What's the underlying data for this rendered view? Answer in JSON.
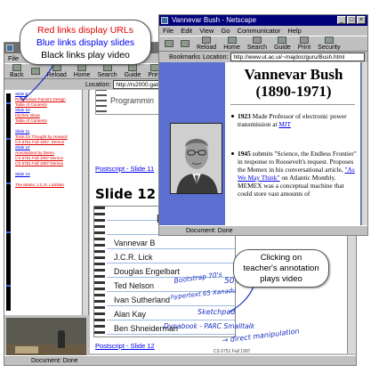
{
  "callouts": {
    "legend": {
      "red_line": "Red links display URLs",
      "blue_line": "Blue links display slides",
      "black_line": "Black links play video"
    },
    "clicking_lines": [
      "Clicking on",
      "teacher's annotation",
      "plays video"
    ]
  },
  "lecture_window": {
    "menu": [
      "File"
    ],
    "toolbar": [
      "Back",
      "",
      "Reload",
      "Home",
      "Search",
      "Guide",
      "Print"
    ],
    "location_label": "Location:",
    "location_value": "http://rs2000.gatech.edu/brotherl/l",
    "status": "Document: Done",
    "index_items": [
      {
        "text": "Slide 9",
        "color": "blue"
      },
      {
        "text": "Red Human Factors Design",
        "color": "red"
      },
      {
        "text": "Table of Contents",
        "color": "red"
      },
      {
        "text": "Slide 10",
        "color": "blue"
      },
      {
        "text": "Kitchen Ideas",
        "color": "red"
      },
      {
        "text": "Table of Contents",
        "color": "red"
      },
      {
        "text": "",
        "color": "gap"
      },
      {
        "text": "Slide 11",
        "color": "blue"
      },
      {
        "text": "Tools for Thought by Howard",
        "color": "red"
      },
      {
        "text": "CS 6751 Fall 1997, Demos",
        "color": "red"
      },
      {
        "text": "Slide 12",
        "color": "blue"
      },
      {
        "text": "Annotations by Demo",
        "color": "red"
      },
      {
        "text": "CS 6751 Fall 1997 Demos",
        "color": "red"
      },
      {
        "text": "CS 6751 Fall 1997 Demos",
        "color": "red"
      },
      {
        "text": "",
        "color": "gap"
      },
      {
        "text": "Slide 13",
        "color": "blue"
      },
      {
        "text": "",
        "color": "gap"
      },
      {
        "text": "The Matrix: J.C.R. Licklider",
        "color": "red"
      }
    ],
    "video_controls": [
      "▶",
      "❚❚",
      "■",
      "◀",
      "▶▶"
    ],
    "slide": {
      "top_link": "Postscript - Slide 11",
      "top_preview": "Programmin",
      "title": "Slide 12",
      "notebook_title": "Mo",
      "rows": [
        {
          "printed": "Vannevar B"
        },
        {
          "printed": "J.C.R. Lick"
        },
        {
          "printed": "Douglas Engelbart",
          "note": "50's → mouse"
        },
        {
          "printed": "Ted Nelson",
          "note": "Bootstrap  70's"
        },
        {
          "printed": "Ivan Sutherland",
          "note": "Sketchpad"
        },
        {
          "printed": "Alan Kay",
          "note": "Dynabook - PARC Smalltalk"
        },
        {
          "printed": "Ben Shneiderman",
          "note": "→ direct manipulation"
        }
      ],
      "hypertext_note": "hypertext  65  Xanadu",
      "footer_stamp": "CS 6751 Fall 1997",
      "bottom_link": "Postscript - Slide 12"
    }
  },
  "netscape_window": {
    "title": "Vannevar Bush - Netscape",
    "menu": [
      "File",
      "Edit",
      "View",
      "Go",
      "Communicator",
      "Help"
    ],
    "toolbar": [
      "",
      "",
      "Reload",
      "Home",
      "Search",
      "Guide",
      "Print",
      "Security"
    ],
    "bookmarks_label": "Bookmarks",
    "location_label": "Location:",
    "location_value": "http://www.ut.ac.ui/~majdoc/guru/Bush.html",
    "status": "Document: Done",
    "page": {
      "title": "Vannevar Bush (1890-1971)",
      "bullet1_year": "1923",
      "bullet1_text": "Made Professor of electronic power transmission at",
      "bullet1_link": "MIT",
      "bullet2_year": "1945",
      "bullet2_text": "submits \"Science, the Endless Frontier\" in response to Roosevelt's request. Proposes the Memex in his conversational article,",
      "bullet2_link": "\"As We May Think\"",
      "bullet2_tail": "on Atlantic Monthly. MEMEX was a conceptual machine that could store vast amounts of"
    }
  },
  "colors": {
    "link_red": "#e00000",
    "link_blue": "#0000ee",
    "titlebar_active": "#00007b",
    "page_side_panel": "#5a6fd0"
  }
}
